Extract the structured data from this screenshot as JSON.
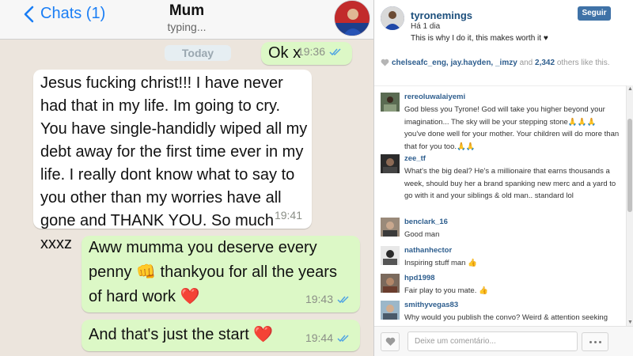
{
  "chat": {
    "back_label": "Chats (1)",
    "contact_name": "Mum",
    "contact_status": "typing...",
    "date_separator": "Today",
    "messages": [
      {
        "direction": "out",
        "text": "Ok x",
        "time": "19:36",
        "read": true
      },
      {
        "direction": "in",
        "text": "Jesus fucking christ!!! I have never had that in my life. Im going to cry. You have single-handidly wiped all my debt away for the first time ever in my life. I really dont know what to say to you other than my worries have all gone and THANK YOU. So much xxxz",
        "time": "19:41"
      },
      {
        "direction": "out",
        "text": "Aww mumma you deserve every penny 👊 thankyou for all the years of hard work ❤️",
        "time": "19:43",
        "read": true
      },
      {
        "direction": "out",
        "text": "And that's just the start ❤️",
        "time": "19:44",
        "read": true
      }
    ],
    "colors": {
      "accent": "#1a7ef5",
      "outgoing_bubble": "#dcf8c6",
      "incoming_bubble": "#ffffff",
      "background": "#ece5dd",
      "read_ticks": "#4fa3e3"
    }
  },
  "instagram": {
    "username": "tyronemings",
    "time_ago": "Há 1 dia",
    "caption": "This is why I do it, this makes worth it ♥",
    "follow_label": "Seguir",
    "likes": {
      "users": "chelseafc_eng, jay.hayden, _imzy",
      "and_text": "and",
      "count": "2,342",
      "suffix": "others like this."
    },
    "comments": [
      {
        "user": "rereoluwalaiyemi",
        "text": "God bless you Tyrone! God will take you higher beyond your imagination... The sky will be your stepping stone🙏🙏🙏 you've done well for your mother. Your children will do more than that for you too.🙏🙏"
      },
      {
        "user": "zee_tf",
        "text": "What's the big deal? He's a millionaire that earns thousands a week, should buy her a brand spanking new merc and a yard to go with it and your siblings & old man.. standard lol"
      },
      {
        "user": "benclark_16",
        "text": "Good man"
      },
      {
        "user": "nathanhector",
        "text": "Inspiring stuff man 👍"
      },
      {
        "user": "hpd1998",
        "text": "Fair play to you mate. 👍"
      },
      {
        "user": "smithyvegas83",
        "text": "Why would you publish the convo? Weird & attention seeking"
      }
    ],
    "comment_placeholder": "Deixe um comentário...",
    "colors": {
      "username": "#1c4f7c",
      "follow_button": "#3f72a7"
    }
  }
}
